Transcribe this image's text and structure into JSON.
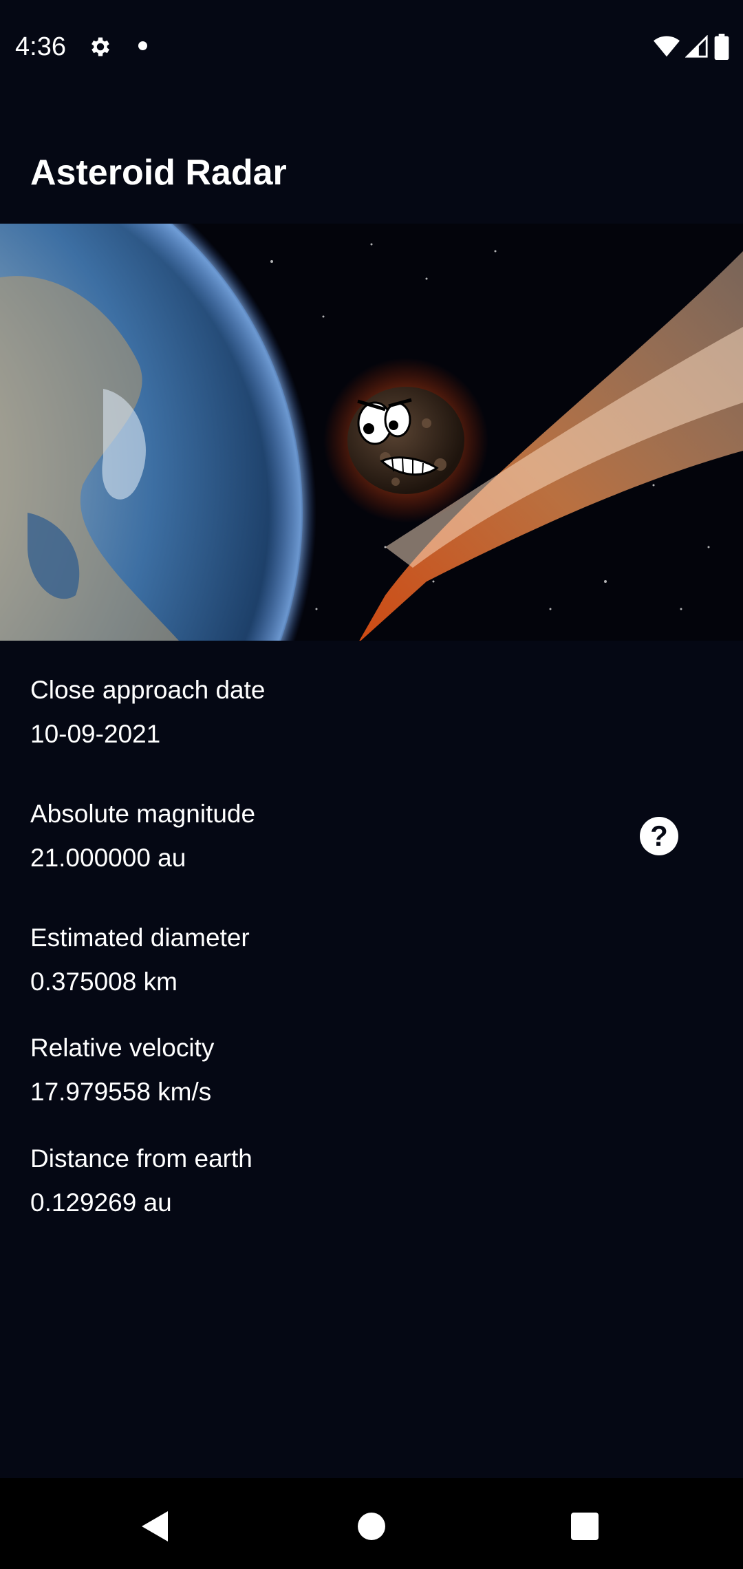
{
  "status_bar": {
    "time": "4:36",
    "icons": [
      "gear-icon",
      "notification-dot-icon",
      "wifi-icon",
      "signal-icon",
      "battery-icon"
    ]
  },
  "app_bar": {
    "title": "Asteroid Radar"
  },
  "hero": {
    "description_icon": "asteroid-hero-image"
  },
  "details": [
    {
      "label": "Close approach date",
      "value": "10-09-2021"
    },
    {
      "label": "Absolute magnitude",
      "value": "21.000000 au"
    },
    {
      "label": "Estimated diameter",
      "value": "0.375008 km"
    },
    {
      "label": "Relative velocity",
      "value": "17.979558 km/s"
    },
    {
      "label": "Distance from earth",
      "value": "0.129269 au"
    }
  ],
  "help": {
    "symbol": "?"
  },
  "nav_bar": {
    "icons": [
      "back-icon",
      "home-icon",
      "recents-icon"
    ]
  },
  "colors": {
    "background": "#050814",
    "text": "#ffffff",
    "nav_bar": "#000000"
  }
}
